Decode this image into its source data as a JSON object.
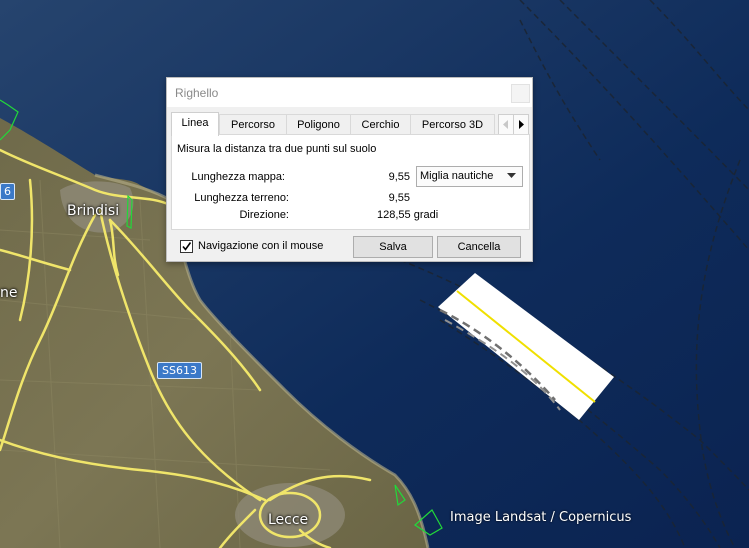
{
  "map": {
    "cities": {
      "brindisi": "Brindisi",
      "lecce": "Lecce",
      "left_partial": "ne"
    },
    "road_labels": {
      "ss613": "SS613",
      "left_shield": "6"
    },
    "attribution": "Image Landsat / Copernicus"
  },
  "dialog": {
    "title": "Righello",
    "tabs": [
      "Linea",
      "Percorso",
      "Poligono",
      "Cerchio",
      "Percorso 3D"
    ],
    "active_tab": "Linea",
    "description": "Misura la distanza tra due punti sul suolo",
    "map_length_label": "Lunghezza mappa:",
    "map_length_value": "9,55",
    "units_selected": "Miglia nautiche",
    "ground_length_label": "Lunghezza terreno:",
    "ground_length_value": "9,55",
    "direction_label": "Direzione:",
    "direction_value": "128,55 gradi",
    "mouse_nav_checked": true,
    "mouse_nav_label": "Navigazione con il mouse",
    "save_label": "Salva",
    "cancel_label": "Cancella"
  }
}
